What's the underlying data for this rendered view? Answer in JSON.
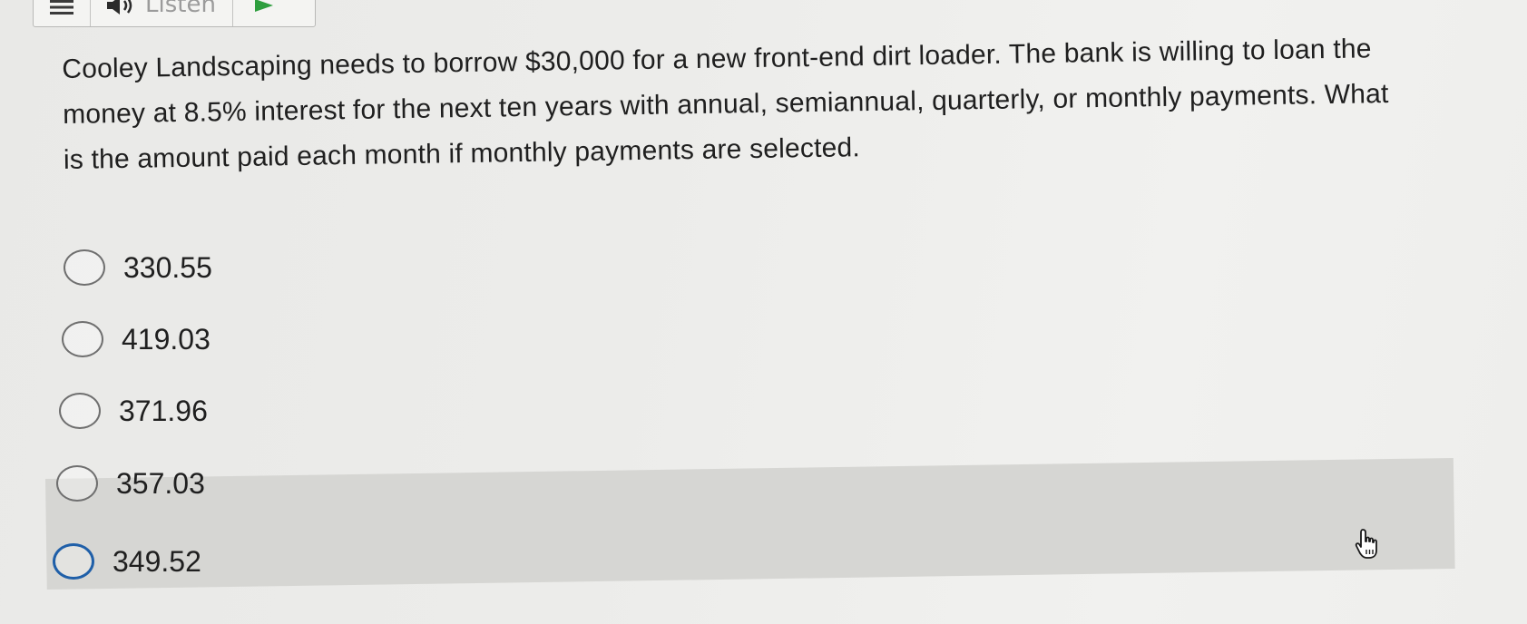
{
  "toolbar": {
    "menu_icon": "hamburger-menu-icon",
    "listen_icon": "speaker-icon",
    "listen_label": "Listen",
    "play_icon": "play-triangle-icon",
    "play_color": "#2e9e3e"
  },
  "question": {
    "text": "Cooley Landscaping needs to borrow $30,000 for a new front-end dirt loader. The bank is willing to loan the money at 8.5% interest for the next ten years with annual, semiannual, quarterly, or monthly payments. What is the amount paid each month if monthly payments are selected."
  },
  "options": [
    {
      "label": "330.55"
    },
    {
      "label": "419.03"
    },
    {
      "label": "371.96"
    },
    {
      "label": "357.03"
    },
    {
      "label": "349.52"
    }
  ],
  "hovered_option_index": 4,
  "colors": {
    "hover_radio": "#1f5fa8",
    "hover_band": "#d6d6d3"
  },
  "cursor": {
    "icon": "hand-pointer-cursor-icon"
  }
}
